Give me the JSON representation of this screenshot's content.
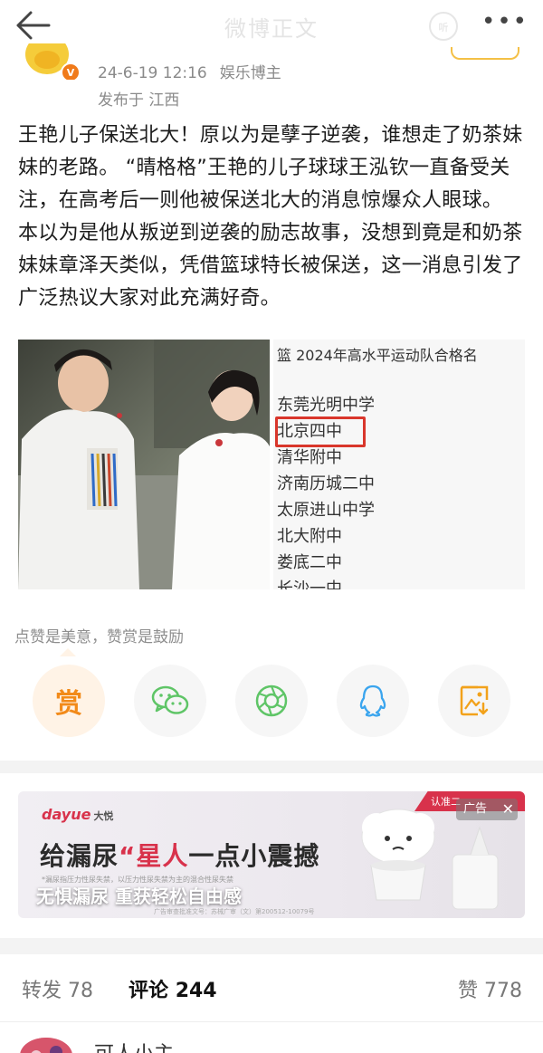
{
  "header": {
    "title": "微博正文",
    "more_label": "•••"
  },
  "post": {
    "date_time": "24-6-19 12:16",
    "source": "娱乐博主",
    "location": "发布于 江西",
    "text": "王艳儿子保送北大！原以为是孽子逆袭，谁想走了奶茶妹妹的老路。 “晴格格”王艳的儿子球球王泓钦一直备受关注，在高考后一则他被保送北大的消息惊爆众人眼球。 本以为是他从叛逆到逆袭的励志故事，没想到竟是和奶茶妹妹章泽天类似，凭借篮球特长被保送，这一消息引发了广泛热议大家对此充满好奇。"
  },
  "image_right": {
    "heading": "篮 2024年高水平运动队合格名",
    "schools": [
      "东莞光明中学",
      "北京四中",
      "清华附中",
      "济南历城二中",
      "太原进山中学",
      "北大附中",
      "娄底二中",
      "长沙一中"
    ]
  },
  "reward": {
    "hint": "点赞是美意，赞赏是鼓励",
    "reward_char": "赏"
  },
  "share_buttons": [
    {
      "name": "reward",
      "icon": "reward-icon"
    },
    {
      "name": "wechat",
      "icon": "wechat-icon",
      "color": "#5fc567"
    },
    {
      "name": "moments",
      "icon": "moments-icon",
      "color": "#5fc567"
    },
    {
      "name": "qq",
      "icon": "qq-icon",
      "color": "#3ba5ee"
    },
    {
      "name": "save-image",
      "icon": "save-image-icon",
      "color": "#f2a21b"
    }
  ],
  "ad": {
    "brand": "dayue",
    "brand_cn": "大悦",
    "headline_prefix": "给漏尿",
    "headline_red": "“星人",
    "headline_suffix": "一点小震撼",
    "slogan": "无惧漏尿 重获轻松自由感",
    "ribbon": "认准二",
    "label": "广告",
    "close": "✕",
    "fine_print": "*漏尿指压力性尿失禁，以压力性尿失禁为主的混合性尿失禁",
    "footer": "广告审查批准文号：苏械广审（文）第200512-10079号"
  },
  "tabs": {
    "repost_label": "转发",
    "repost_count": "78",
    "comment_label": "评论",
    "comment_count": "244",
    "like_label": "赞",
    "like_count": "778"
  },
  "comment_preview": {
    "name": "可人小主"
  },
  "colors": {
    "accent_orange": "#f28a19",
    "meta_gray": "#8a8a8a",
    "ad_red": "#d8324b"
  }
}
